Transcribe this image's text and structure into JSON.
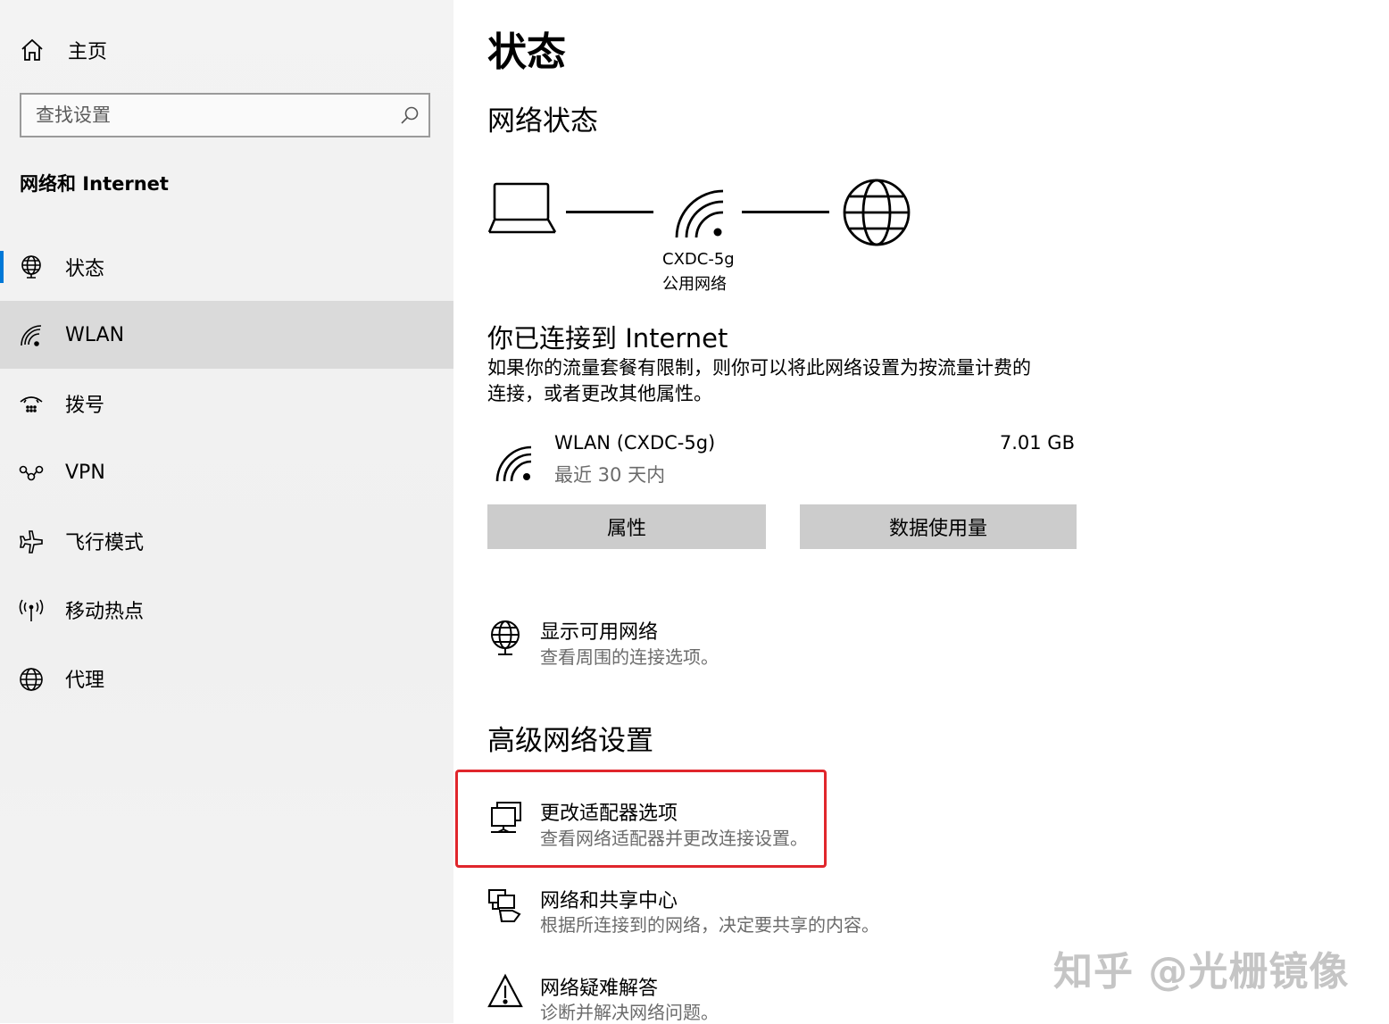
{
  "sidebar": {
    "home_label": "主页",
    "search_placeholder": "查找设置",
    "section_title": "网络和 Internet",
    "items": [
      {
        "label": "状态",
        "icon": "status-globe-icon"
      },
      {
        "label": "WLAN",
        "icon": "wifi-icon"
      },
      {
        "label": "拨号",
        "icon": "dialup-icon"
      },
      {
        "label": "VPN",
        "icon": "vpn-icon"
      },
      {
        "label": "飞行模式",
        "icon": "airplane-icon"
      },
      {
        "label": "移动热点",
        "icon": "hotspot-icon"
      },
      {
        "label": "代理",
        "icon": "globe-icon"
      }
    ],
    "active_item": "状态",
    "selected_item": "WLAN"
  },
  "main": {
    "page_title": "状态",
    "network_status_heading": "网络状态",
    "diagram": {
      "network_name": "CXDC-5g",
      "network_type": "公用网络"
    },
    "connected_heading": "你已连接到 Internet",
    "connected_desc_line1": "如果你的流量套餐有限制，则你可以将此网络设置为按流量计费的",
    "connected_desc_line2": "连接，或者更改其他属性。",
    "usage": {
      "name": "WLAN (CXDC-5g)",
      "period": "最近 30 天内",
      "amount": "7.01 GB"
    },
    "buttons": {
      "properties": "属性",
      "data_usage": "数据使用量"
    },
    "show_networks": {
      "title": "显示可用网络",
      "subtitle": "查看周围的连接选项。"
    },
    "advanced_heading": "高级网络设置",
    "advanced_links": [
      {
        "title": "更改适配器选项",
        "subtitle": "查看网络适配器并更改连接设置。",
        "icon": "adapter-icon"
      },
      {
        "title": "网络和共享中心",
        "subtitle": "根据所连接到的网络，决定要共享的内容。",
        "icon": "sharing-center-icon"
      },
      {
        "title": "网络疑难解答",
        "subtitle": "诊断并解决网络问题。",
        "icon": "warning-icon"
      }
    ],
    "highlight_color": "#e0262c"
  },
  "watermark": "知乎 @光栅镜像",
  "accent_color": "#0078d7"
}
